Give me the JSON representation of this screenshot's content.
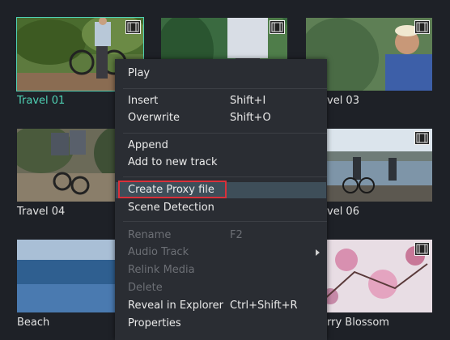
{
  "media": [
    {
      "label": "Travel 01",
      "selected": true
    },
    {
      "label": "",
      "selected": false
    },
    {
      "label": "vel 03",
      "selected": false
    },
    {
      "label": "Travel 04",
      "selected": false
    },
    {
      "label": "",
      "selected": false
    },
    {
      "label": "vel 06",
      "selected": false
    },
    {
      "label": "Beach",
      "selected": false
    },
    {
      "label": "",
      "selected": false
    },
    {
      "label": "rry Blossom",
      "selected": false
    }
  ],
  "context_menu": {
    "play": "Play",
    "insert": "Insert",
    "insert_shortcut": "Shift+I",
    "overwrite": "Overwrite",
    "overwrite_shortcut": "Shift+O",
    "append": "Append",
    "add_to_new_track": "Add to new track",
    "create_proxy_file": "Create Proxy file",
    "scene_detection": "Scene Detection",
    "rename": "Rename",
    "rename_shortcut": "F2",
    "audio_track": "Audio Track",
    "relink_media": "Relink Media",
    "delete": "Delete",
    "reveal_in_explorer": "Reveal in Explorer",
    "reveal_shortcut": "Ctrl+Shift+R",
    "properties": "Properties"
  },
  "colors": {
    "background": "#1e2127",
    "menu_bg": "#2a2d33",
    "selected_accent": "#4fd1b4",
    "highlight_bg": "#3e4e59",
    "highlight_border": "#d9303a",
    "disabled_text": "#6c6f75"
  },
  "icons": {
    "film": "film-strip-icon",
    "submenu": "chevron-right-icon"
  }
}
